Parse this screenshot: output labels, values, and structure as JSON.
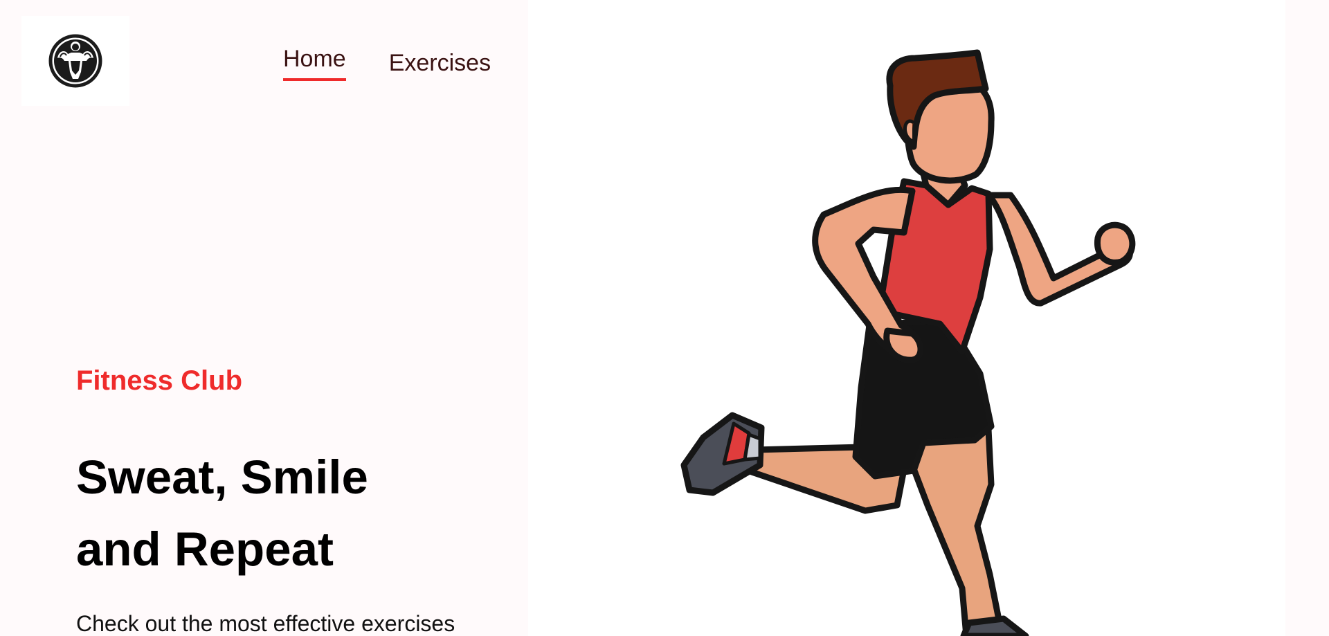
{
  "nav": {
    "items": [
      {
        "label": "Home",
        "active": true
      },
      {
        "label": "Exercises",
        "active": false
      }
    ]
  },
  "logo": {
    "icon": "bodybuilder-logo-icon"
  },
  "hero": {
    "label": "Fitness Club",
    "headline_line1": "Sweat, Smile",
    "headline_line2": "and Repeat",
    "subtext": "Check out the most effective exercises",
    "illustration": "running-man-illustration"
  },
  "colors": {
    "accent": "#ef2b2b",
    "page_background": "#fffafb",
    "nav_text": "#3a1212",
    "shirt": "#dd3f3f",
    "skin": "#eea583",
    "hair": "#6b2a12"
  }
}
